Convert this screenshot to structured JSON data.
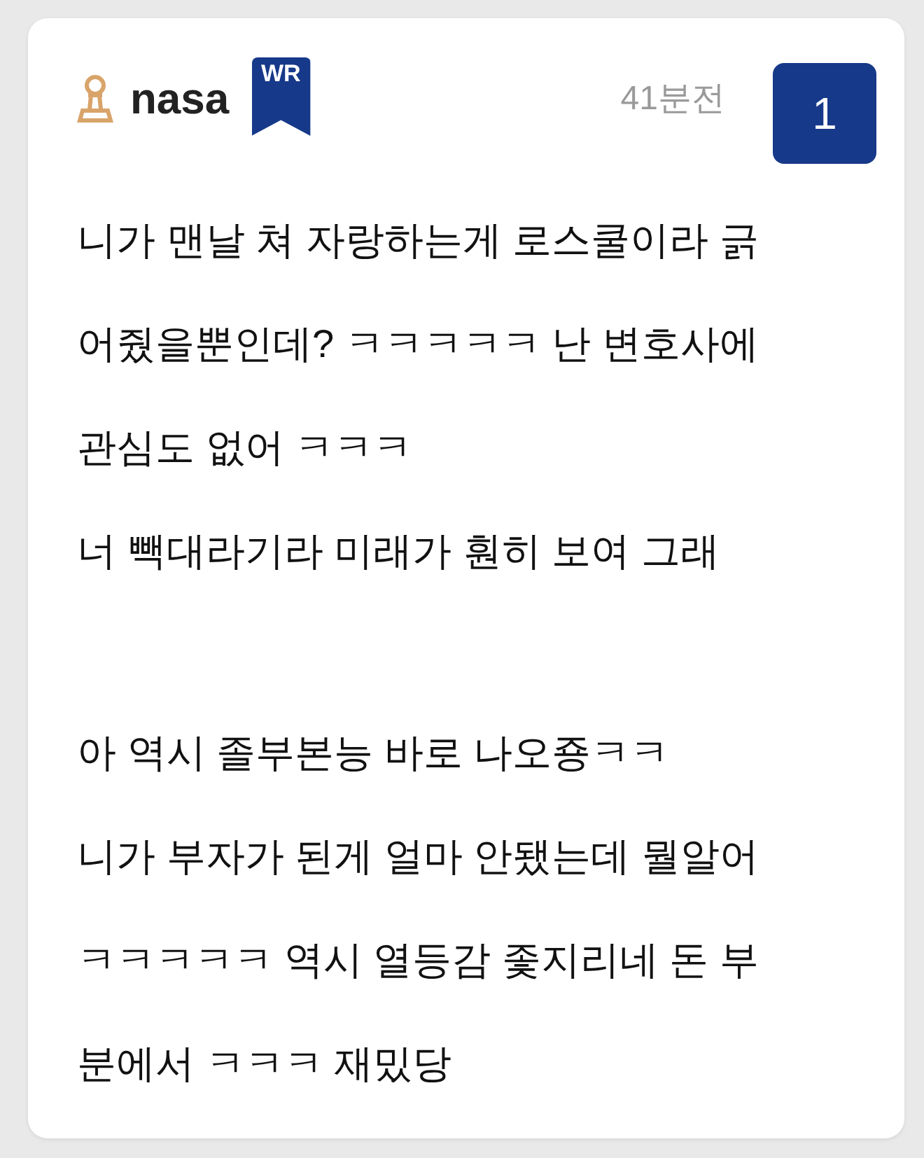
{
  "author": {
    "name": "nasa",
    "badge": "WR"
  },
  "time": "41분전",
  "number": "1",
  "paragraphs": [
    [
      "니가 맨날 쳐 자랑하는게 로스쿨이라 긁",
      "어줬을뿐인데? ㅋㅋㅋㅋㅋ 난 변호사에",
      "관심도 없어 ㅋㅋㅋ",
      "너 빽대라기라 미래가 훤히 보여 그래"
    ],
    [
      "아 역시 졸부본능 바로 나오죵ㅋㅋ",
      "니가 부자가 된게 얼마 안됐는데 뭘알어",
      "ㅋㅋㅋㅋㅋ 역시 열등감 좇지리네 돈 부",
      "분에서 ㅋㅋㅋ 재밌당"
    ]
  ]
}
